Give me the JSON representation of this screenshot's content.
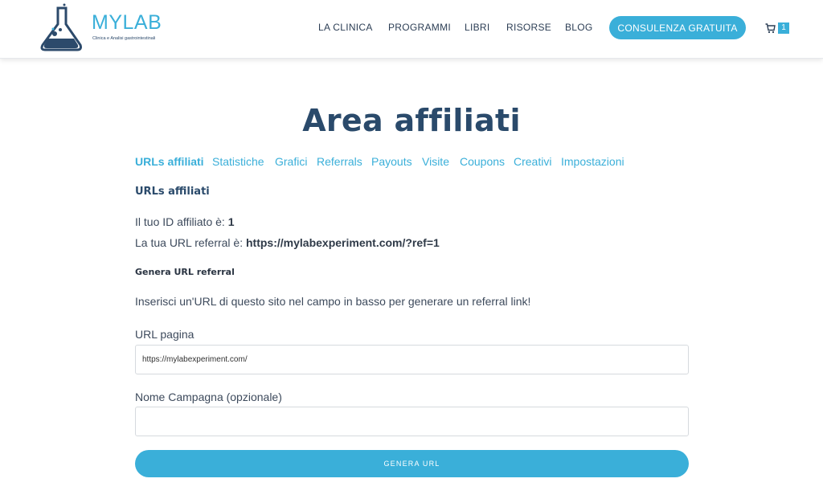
{
  "header": {
    "logo": {
      "wordmark": "MYLAB",
      "tagline": "Clinica e Analisi gastrointestinali"
    },
    "nav": [
      {
        "label": "LA CLINICA"
      },
      {
        "label": "PROGRAMMI"
      },
      {
        "label": "LIBRI"
      },
      {
        "label": "RISORSE"
      },
      {
        "label": "BLOG"
      }
    ],
    "cta_label": "CONSULENZA GRATUITA",
    "cart": {
      "icon": "cart-icon",
      "count": "1"
    }
  },
  "page": {
    "title": "Area affiliati",
    "tabs": [
      {
        "label": "URLs affiliati",
        "active": true
      },
      {
        "label": "Statistiche"
      },
      {
        "label": "Grafici"
      },
      {
        "label": "Referrals"
      },
      {
        "label": "Payouts"
      },
      {
        "label": "Visite"
      },
      {
        "label": "Coupons"
      },
      {
        "label": "Creativi"
      },
      {
        "label": "Impostazioni"
      }
    ],
    "section_heading": "URLs affiliati",
    "affiliate_id_label": "Il tuo ID affiliato è:",
    "affiliate_id_value": "1",
    "referral_url_label": "La tua URL referral è:",
    "referral_url_value": "https://mylabexperiment.com/?ref=1",
    "generate_heading": "Genera URL referral",
    "instructions": "Inserisci un'URL di questo sito nel campo in basso per generare un referral link!",
    "form": {
      "page_url_label": "URL pagina",
      "page_url_value": "https://mylabexperiment.com/",
      "campaign_label": "Nome Campagna (opzionale)",
      "campaign_value": "",
      "submit_label": "GENERA URL"
    }
  },
  "colors": {
    "accent": "#3aafd9",
    "heading": "#2a4a6b",
    "text": "#3d4a5c"
  }
}
